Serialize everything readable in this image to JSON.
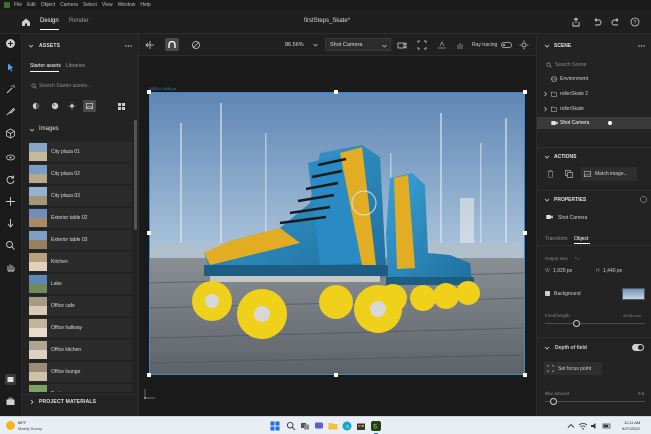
{
  "menubar": {
    "items": [
      "File",
      "Edit",
      "Object",
      "Camera",
      "Select",
      "View",
      "Window",
      "Help"
    ]
  },
  "topbar": {
    "tabs": [
      "Design",
      "Render"
    ],
    "document_title": "firstSteps_Skate*"
  },
  "assets": {
    "section_title": "ASSETS",
    "subtabs": [
      "Starter assets",
      "Libraries"
    ],
    "search_placeholder": "Search Starter assets...",
    "images_title": "Images",
    "items": [
      "City plaza 01",
      "City plaza 02",
      "City plaza 03",
      "Exterior table 02",
      "Exterior table 03",
      "Kitchen",
      "Lake",
      "Office cafe",
      "Office hallway",
      "Office kitchen",
      "Office lounge",
      "Park"
    ],
    "project_materials": "PROJECT MATERIALS"
  },
  "toolbar": {
    "zoom": "86.56%",
    "camera_select": "Shot Camera",
    "ray_tracing": "Ray tracing"
  },
  "viewport": {
    "size_label": "1920 x 1440 px"
  },
  "scene": {
    "title": "SCENE",
    "search_placeholder": "Search Scene",
    "items": [
      "Environment",
      "rollerSkate 2",
      "rollerSkate",
      "Shot Camera"
    ]
  },
  "actions": {
    "title": "ACTIONS",
    "match_image": "Match image..."
  },
  "properties": {
    "title": "PROPERTIES",
    "object_name": "Shot Camera",
    "tabs": [
      "Transform",
      "Object"
    ],
    "output_size_label": "Output size",
    "width_label": "W",
    "width_value": "1,920 px",
    "height_label": "H",
    "height_value": "1,440 px",
    "background_label": "Background",
    "focal_length_label": "Focal length",
    "focal_length_value": "43.96 mm",
    "dof_label": "Depth of field",
    "set_focus": "Set focus point",
    "blur_label": "Blur amount",
    "blur_value": "0.6"
  },
  "taskbar": {
    "weather_temp": "68°F",
    "weather_desc": "Mostly Sunny",
    "time": "11:11 AM",
    "date": "9/27/2022"
  },
  "colors": {
    "accent": "#3a8ad6",
    "skate_blue": "#2a8bc4",
    "skate_yellow": "#e9b81f",
    "wheel_yellow": "#f0d21a"
  }
}
